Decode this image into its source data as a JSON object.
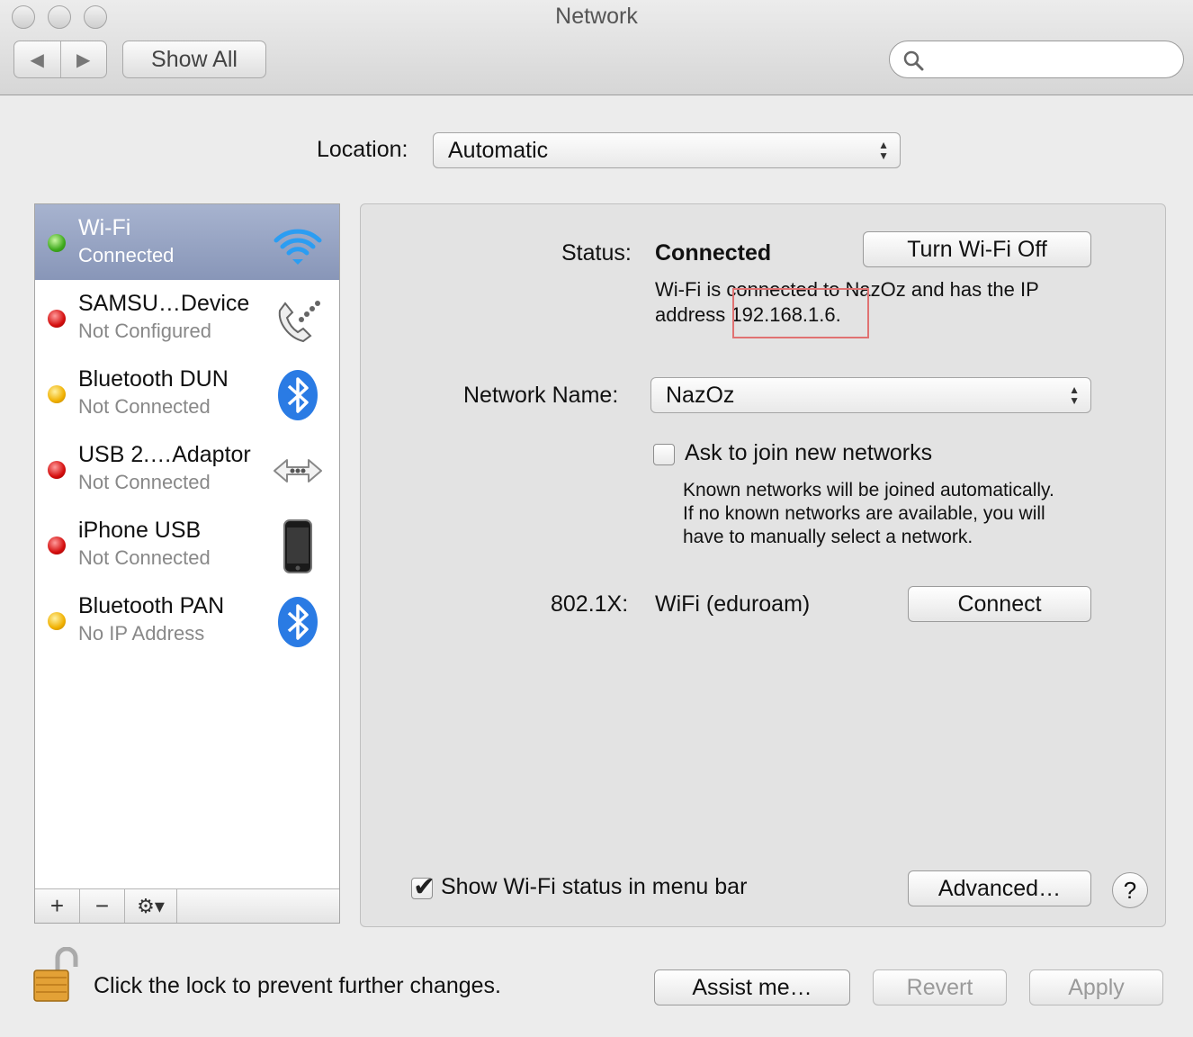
{
  "window": {
    "title": "Network"
  },
  "toolbar": {
    "back": "◀",
    "forward": "▶",
    "show_all": "Show All",
    "search_placeholder": ""
  },
  "location": {
    "label": "Location:",
    "value": "Automatic"
  },
  "services": [
    {
      "name": "Wi-Fi",
      "status": "Connected",
      "status_color": "green",
      "icon": "wifi-icon"
    },
    {
      "name": "SAMSU…Device",
      "status": "Not Configured",
      "status_color": "red",
      "icon": "phone-modem-icon"
    },
    {
      "name": "Bluetooth DUN",
      "status": "Not Connected",
      "status_color": "amber",
      "icon": "bluetooth-icon"
    },
    {
      "name": "USB 2.…Adaptor",
      "status": "Not Connected",
      "status_color": "red",
      "icon": "ethernet-arrows-icon"
    },
    {
      "name": "iPhone USB",
      "status": "Not Connected",
      "status_color": "red",
      "icon": "iphone-icon"
    },
    {
      "name": "Bluetooth PAN",
      "status": "No IP Address",
      "status_color": "amber",
      "icon": "bluetooth-icon"
    }
  ],
  "sidebar_buttons": {
    "add": "+",
    "remove": "−",
    "action": "⚙▾"
  },
  "detail": {
    "status_label": "Status:",
    "status_value": "Connected",
    "turn_off_button": "Turn Wi-Fi Off",
    "status_desc_line1_a": "Wi-Fi is connected to NazOz and has the IP",
    "status_desc_line2_a": "address",
    "status_desc_ip": "192.168.1.6.",
    "network_name_label": "Network Name:",
    "network_name_value": "NazOz",
    "ask_join_label": "Ask to join new networks",
    "ask_join_desc": [
      "Known networks will be joined automatically.",
      "If no known networks are available, you will",
      "have to manually select a network."
    ],
    "dot1x_label": "802.1X:",
    "dot1x_value": "WiFi (eduroam)",
    "connect_button": "Connect",
    "show_status_label": "Show Wi-Fi status in menu bar",
    "advanced_button": "Advanced…",
    "help_button": "?"
  },
  "footer": {
    "lock_text": "Click the lock to prevent further changes.",
    "assist_button": "Assist me…",
    "revert_button": "Revert",
    "apply_button": "Apply"
  }
}
